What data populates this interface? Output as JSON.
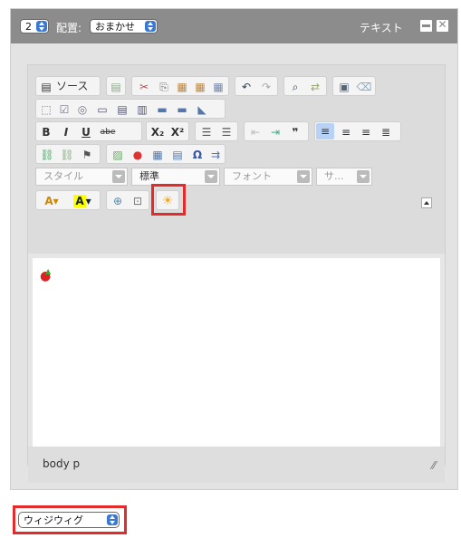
{
  "header": {
    "size_value": "2",
    "align_label": "配置:",
    "align_value": "おまかせ",
    "type_label": "テキスト"
  },
  "toolbar": {
    "source_label": "ソース",
    "style_placeholder": "スタイル",
    "format_value": "標準",
    "font_placeholder": "フォント",
    "size_placeholder": "サ..."
  },
  "editor": {
    "content_icon": "apple-icon"
  },
  "status": {
    "path": "body  p"
  },
  "footer": {
    "mode_value": "ウィジウィグ"
  },
  "colors": {
    "header_bg": "#8c8c8c",
    "highlight": "#e32b2b",
    "spin_blue": "#3a78d6"
  }
}
